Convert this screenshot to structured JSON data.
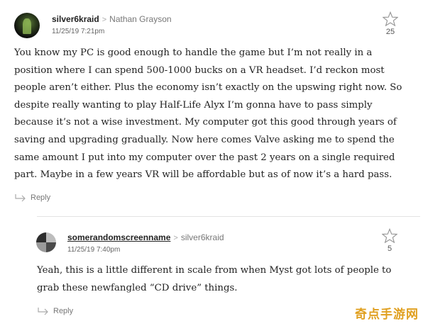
{
  "comments": [
    {
      "author": "silver6kraid",
      "recipient": "Nathan Grayson",
      "timestamp": "11/25/19 7:21pm",
      "stars": "25",
      "body": "You know my PC is good enough to handle the game but I’m not really in a position where I can spend 500-1000 bucks on a VR headset. I’d reckon most people aren’t either. Plus the economy isn’t exactly on the upswing right now. So despite really wanting to play Half-Life Alyx I’m gonna have to pass simply because it’s not a wise investment. My computer got this good through years of saving and upgrading gradually. Now here comes Valve asking me to spend the same amount I put into my computer over the past 2 years on a single required part. Maybe in a few years VR will be affordable but as of now it’s a hard pass.",
      "reply_label": "Reply"
    },
    {
      "author": "somerandomscreenname",
      "recipient": "silver6kraid",
      "timestamp": "11/25/19 7:40pm",
      "stars": "5",
      "body": "Yeah, this is a little different in scale from when Myst got lots of people to grab these newfangled “CD drive” things.",
      "reply_label": "Reply"
    }
  ],
  "watermark": "奇点手游网",
  "icons": {
    "separator": "chevron-right-icon",
    "star": "star-icon",
    "reply": "reply-arrow-icon"
  },
  "colors": {
    "text": "#222222",
    "muted": "#777777",
    "watermark": "#e0a020"
  }
}
